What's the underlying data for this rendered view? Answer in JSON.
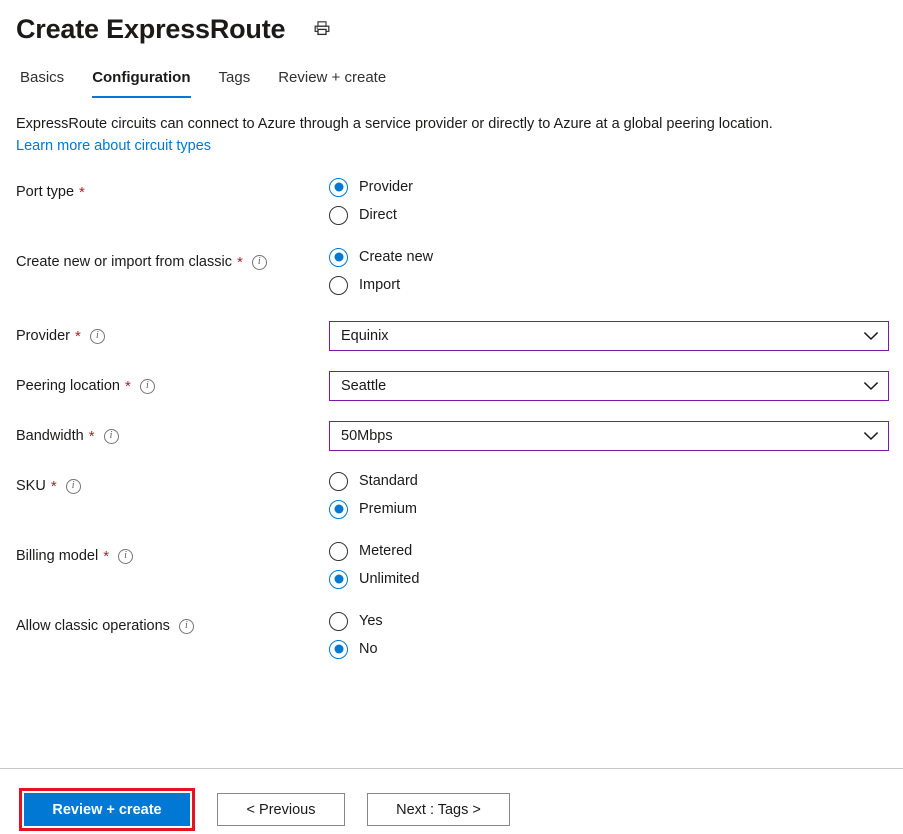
{
  "header": {
    "title": "Create ExpressRoute",
    "print_icon": "printer-icon"
  },
  "tabs": [
    {
      "label": "Basics",
      "active": false
    },
    {
      "label": "Configuration",
      "active": true
    },
    {
      "label": "Tags",
      "active": false
    },
    {
      "label": "Review + create",
      "active": false
    }
  ],
  "intro": {
    "text": "ExpressRoute circuits can connect to Azure through a service provider or directly to Azure at a global peering location.",
    "link": "Learn more about circuit types",
    "link_color": "#0078d4"
  },
  "fields": [
    {
      "name": "port-type",
      "label": "Port type",
      "required": true,
      "info": false,
      "type": "radio",
      "options": [
        {
          "label": "Provider",
          "checked": true
        },
        {
          "label": "Direct",
          "checked": false
        }
      ]
    },
    {
      "name": "create-new-or-import",
      "label": "Create new or import from classic",
      "required": true,
      "info": true,
      "type": "radio",
      "options": [
        {
          "label": "Create new",
          "checked": true
        },
        {
          "label": "Import",
          "checked": false
        }
      ]
    },
    {
      "name": "provider",
      "label": "Provider",
      "required": true,
      "info": true,
      "type": "select",
      "value": "Equinix"
    },
    {
      "name": "peering-location",
      "label": "Peering location",
      "required": true,
      "info": true,
      "type": "select",
      "value": "Seattle"
    },
    {
      "name": "bandwidth",
      "label": "Bandwidth",
      "required": true,
      "info": true,
      "type": "select",
      "value": "50Mbps"
    },
    {
      "name": "sku",
      "label": "SKU",
      "required": true,
      "info": true,
      "type": "radio",
      "options": [
        {
          "label": "Standard",
          "checked": false
        },
        {
          "label": "Premium",
          "checked": true
        }
      ]
    },
    {
      "name": "billing-model",
      "label": "Billing model",
      "required": true,
      "info": true,
      "type": "radio",
      "options": [
        {
          "label": "Metered",
          "checked": false
        },
        {
          "label": "Unlimited",
          "checked": true
        }
      ]
    },
    {
      "name": "allow-classic-operations",
      "label": "Allow classic operations",
      "required": false,
      "info": true,
      "type": "radio",
      "options": [
        {
          "label": "Yes",
          "checked": false
        },
        {
          "label": "No",
          "checked": true
        }
      ]
    }
  ],
  "footer": {
    "review_create": "Review + create",
    "previous": "< Previous",
    "next": "Next : Tags >",
    "primary_color": "#0078d4",
    "highlight_color": "#e81123"
  }
}
